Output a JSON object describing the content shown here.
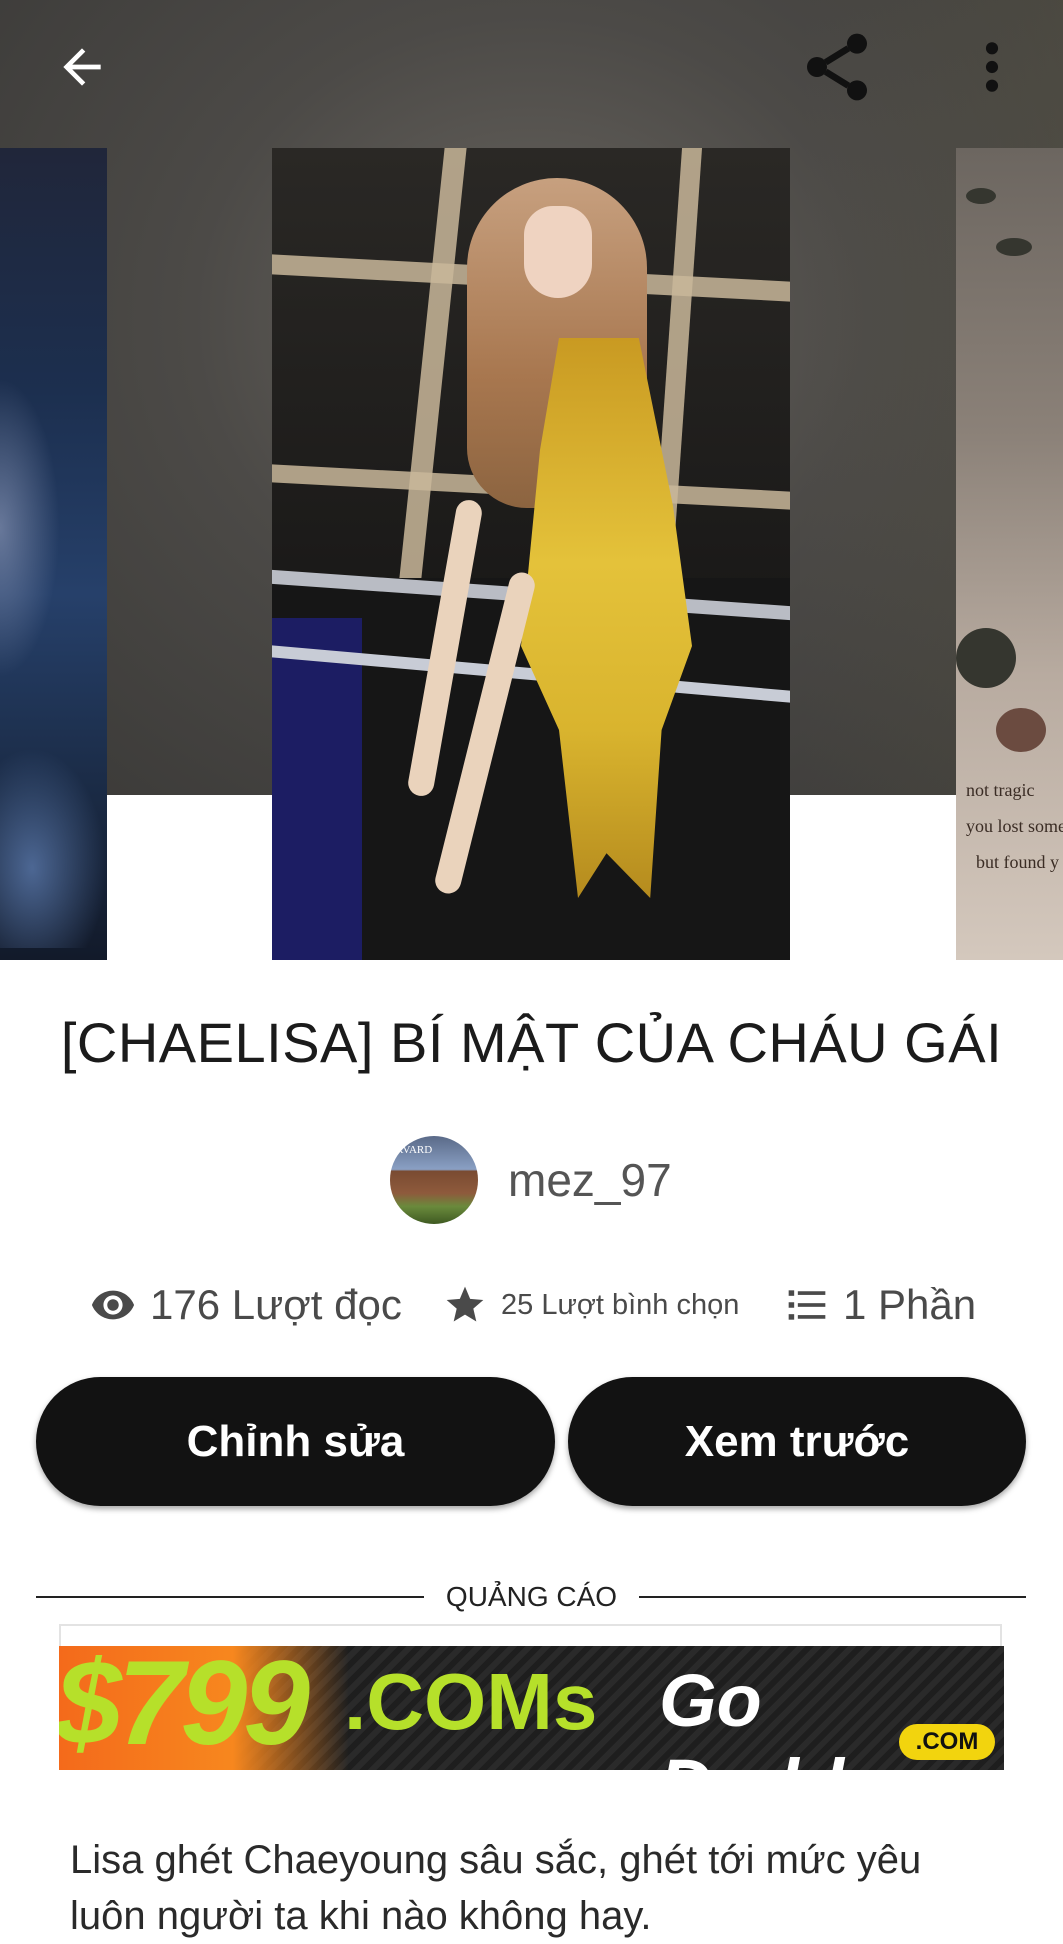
{
  "story": {
    "title": "[CHAELISA] BÍ MẬT CỦA CHÁU GÁI",
    "author": "mez_97",
    "avatar_text": "RVARD",
    "stats": {
      "reads": "176 Lượt đọc",
      "votes": "25 Lượt bình chọn",
      "parts": "1 Phần"
    },
    "description": "Lisa ghét Chaeyoung sâu sắc, ghét tới mức yêu luôn người ta khi nào không hay."
  },
  "actions": {
    "edit_label": "Chỉnh sửa",
    "preview_label": "Xem trước"
  },
  "ad": {
    "label": "QUẢNG CÁO",
    "price": "$799",
    "coms": ".COMs",
    "brand": "Go Daddy",
    "dotcom": ".COM"
  },
  "cover_right_text": [
    "not tragic",
    "you lost some",
    "but found y"
  ],
  "icons": {
    "back": "arrow-left-icon",
    "share": "share-icon",
    "more": "more-vertical-icon",
    "reads": "eye-icon",
    "votes": "star-icon",
    "parts": "list-icon"
  },
  "colors": {
    "button_bg": "#121212",
    "button_text": "#ffffff",
    "hero_bg": "#4c4a47"
  }
}
